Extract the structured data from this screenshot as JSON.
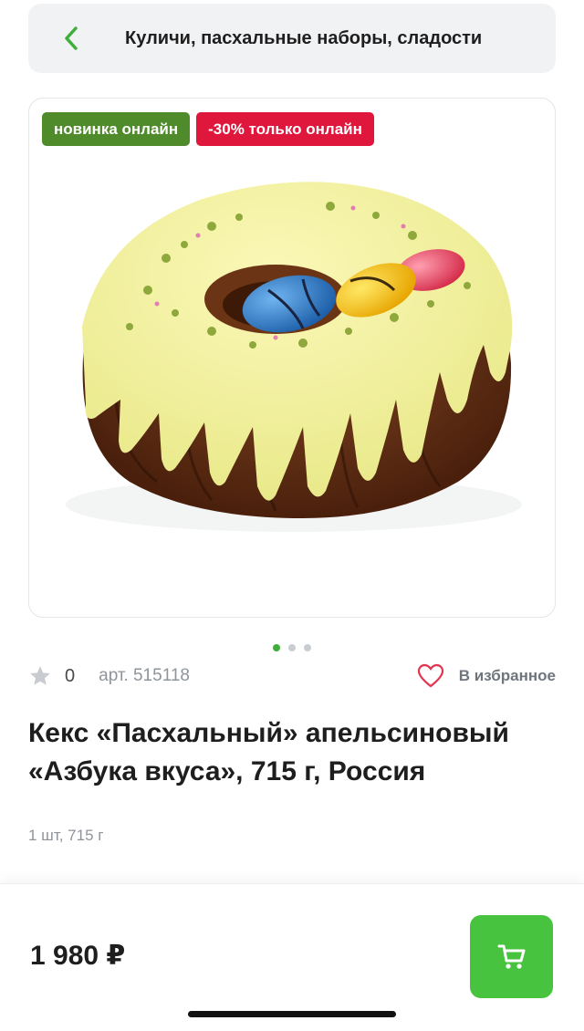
{
  "header": {
    "title": "Куличи, пасхальные наборы, сладости",
    "back_icon": "chevron-left-icon",
    "accent": "#3fae3a"
  },
  "badges": {
    "new": "новинка онлайн",
    "sale": "-30% только онлайн",
    "new_color": "#4f8a2b",
    "sale_color": "#e0173c"
  },
  "gallery": {
    "total": 3,
    "active": 1
  },
  "meta": {
    "rating_count": "0",
    "article": "арт. 515118",
    "favorite_label": "В избранное",
    "star_icon": "star-icon",
    "heart_icon": "heart-icon"
  },
  "product": {
    "title": "Кекс «Пасхальный» апельсиновый «Азбука вкуса», 715 г, Россия",
    "weight": "1 шт, 715 г"
  },
  "purchase": {
    "price": "1 980 ₽",
    "cart_icon": "cart-icon",
    "button_color": "#48c340"
  }
}
